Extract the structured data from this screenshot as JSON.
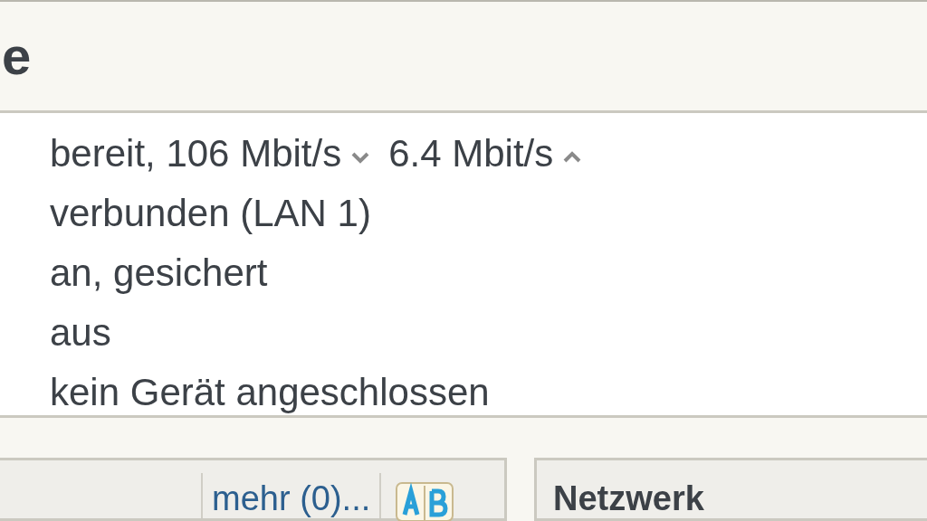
{
  "header": {
    "title": "e"
  },
  "status": {
    "dsl": {
      "downstream": "bereit, 106 Mbit/s",
      "upstream": "6.4 Mbit/s"
    },
    "lines": [
      "verbunden (LAN 1)",
      "an, gesichert",
      "aus",
      "kein Gerät angeschlossen"
    ]
  },
  "left_box": {
    "more_link": "mehr (0)..."
  },
  "right_box": {
    "title": "Netzwerk"
  }
}
